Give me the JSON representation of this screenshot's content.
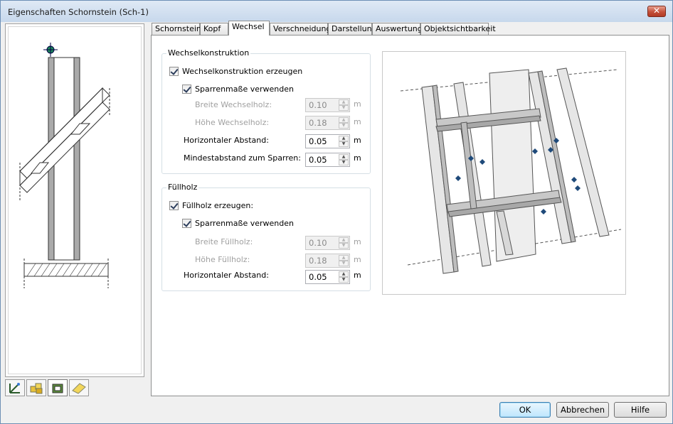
{
  "window": {
    "title": "Eigenschaften Schornstein (Sch-1)",
    "close": "✕"
  },
  "tabs": [
    "Schornstein",
    "Kopf",
    "Wechsel",
    "Verschneidung",
    "Darstellung",
    "Auswertung",
    "Objektsichtbarkeit"
  ],
  "active_tab": "Wechsel",
  "wechsel": {
    "title": "Wechselkonstruktion",
    "create": {
      "label": "Wechselkonstruktion erzeugen",
      "checked": true
    },
    "use_rafter": {
      "label": "Sparrenmaße verwenden",
      "checked": true
    },
    "breite": {
      "label": "Breite Wechselholz:",
      "value": "0.10",
      "unit": "m"
    },
    "hoehe": {
      "label": "Höhe Wechselholz:",
      "value": "0.18",
      "unit": "m"
    },
    "horiz": {
      "label": "Horizontaler Abstand:",
      "value": "0.05",
      "unit": "m"
    },
    "min": {
      "label": "Mindestabstand zum Sparren:",
      "value": "0.05",
      "unit": "m"
    }
  },
  "fuell": {
    "title": "Füllholz",
    "create": {
      "label": "Füllholz erzeugen:",
      "checked": true
    },
    "use_rafter": {
      "label": "Sparrenmaße verwenden",
      "checked": true
    },
    "breite": {
      "label": "Breite Füllholz:",
      "value": "0.10",
      "unit": "m"
    },
    "hoehe": {
      "label": "Höhe Füllholz:",
      "value": "0.18",
      "unit": "m"
    },
    "horiz": {
      "label": "Horizontaler Abstand:",
      "value": "0.05",
      "unit": "m"
    }
  },
  "buttons": {
    "ok": "OK",
    "cancel": "Abbrechen",
    "help": "Hilfe"
  },
  "view_icons": [
    "elevation-view-icon",
    "3d-blocks-icon",
    "roof-view-icon",
    "plan-view-icon"
  ]
}
